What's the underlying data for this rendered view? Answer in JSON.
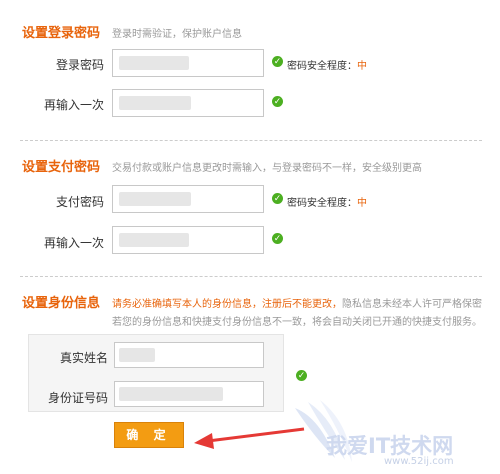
{
  "login_section": {
    "title": "设置登录密码",
    "note": "登录时需验证，保护账户信息",
    "password_label": "登录密码",
    "repeat_label": "再输入一次",
    "strength_label": "密码安全程度：",
    "strength_level": "中"
  },
  "pay_section": {
    "title": "设置支付密码",
    "note": "交易付款或账户信息更改时需输入，与登录密码不一样，安全级别更高",
    "password_label": "支付密码",
    "repeat_label": "再输入一次",
    "strength_label": "密码安全程度：",
    "strength_level": "中"
  },
  "id_section": {
    "title": "设置身份信息",
    "note_warn": "请务必准确填写本人的身份信息，注册后不能更改，",
    "note_rest": "隐私信息未经本人许可严格保密",
    "note_line2": "若您的身份信息和快捷支付身份信息不一致，将会自动关闭已开通的快捷支付服务。",
    "name_label": "真实姓名",
    "idnum_label": "身份证号码"
  },
  "confirm_label": "确 定",
  "watermark": {
    "text": "我爱IT技术网",
    "url": "www.52ij.com"
  },
  "colors": {
    "accent": "#e8640c",
    "ok": "#4caf21",
    "button": "#f39c12",
    "arrow": "#e53935"
  }
}
